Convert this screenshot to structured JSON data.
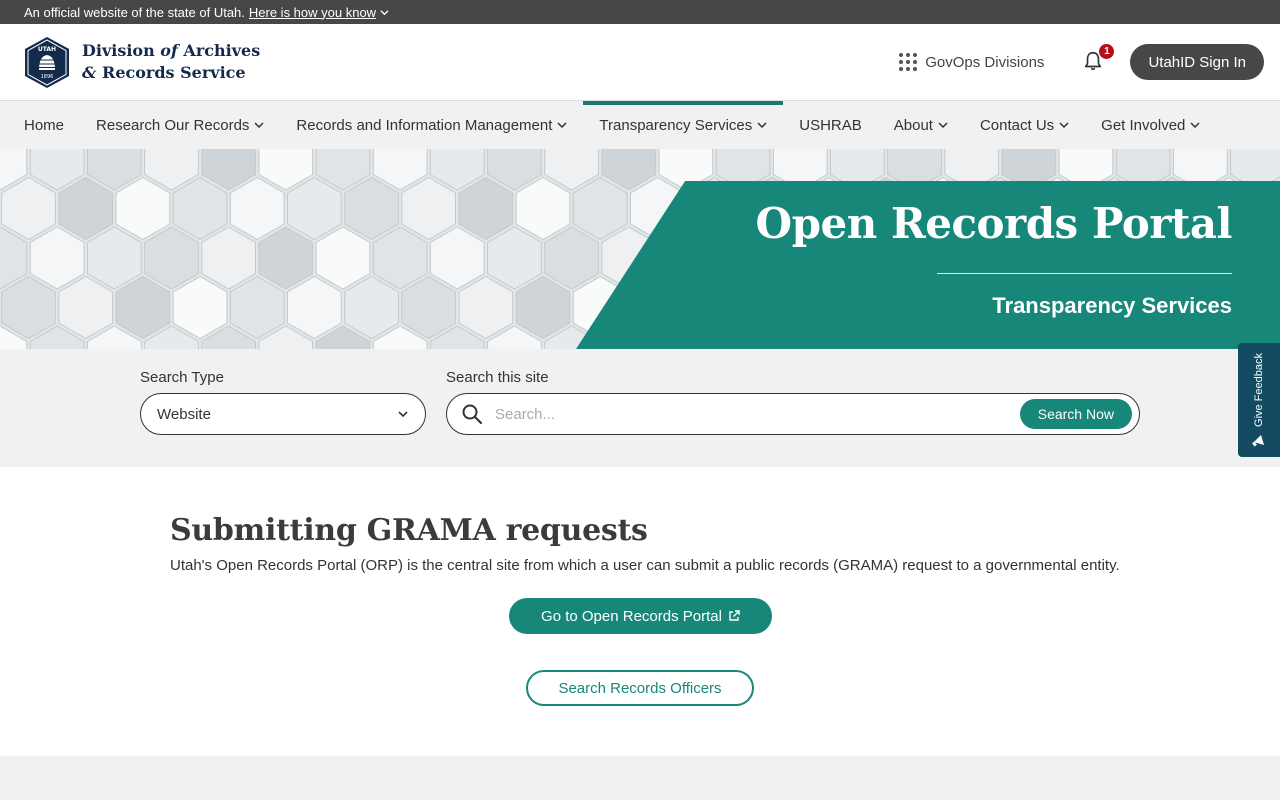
{
  "official_banner": {
    "text": "An official website of the state of Utah.",
    "link": "Here is how you know"
  },
  "header": {
    "logo_line1_a": "Division ",
    "logo_line1_b": "of",
    "logo_line1_c": " Archives",
    "logo_line2_a": "&",
    "logo_line2_b": " Records Service",
    "seal_text": "UTAH",
    "seal_year": "1896",
    "govops_label": "GovOps Divisions",
    "notification_count": "1",
    "signin_label": "UtahID Sign In"
  },
  "nav": {
    "items": [
      {
        "label": "Home"
      },
      {
        "label": "Research Our Records"
      },
      {
        "label": "Records and Information Management"
      },
      {
        "label": "Transparency Services"
      },
      {
        "label": "USHRAB"
      },
      {
        "label": "About"
      },
      {
        "label": "Contact Us"
      },
      {
        "label": "Get Involved"
      }
    ]
  },
  "hero": {
    "title": "Open Records Portal",
    "subtitle": "Transparency Services"
  },
  "search": {
    "type_label": "Search Type",
    "type_value": "Website",
    "site_label": "Search this site",
    "placeholder": "Search...",
    "button_label": "Search Now"
  },
  "feedback": {
    "label": "Give Feedback"
  },
  "content": {
    "heading": "Submitting GRAMA requests",
    "description": "Utah's Open Records Portal (ORP) is the central site from which a user can submit a public records (GRAMA) request to a governmental entity.",
    "primary_button": "Go to Open Records Portal",
    "secondary_button": "Search Records Officers"
  },
  "colors": {
    "teal": "#17877a",
    "navy": "#142a4a",
    "banner_gray": "#474747",
    "feedback_blue": "#134b63",
    "badge_red": "#b40f1c"
  }
}
